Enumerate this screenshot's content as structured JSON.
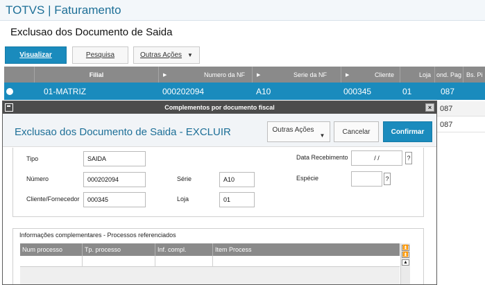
{
  "app": {
    "title": "TOTVS | Faturamento"
  },
  "page": {
    "title": "Exclusao dos Documento de Saida"
  },
  "toolbar": {
    "visualizar": "Visualizar",
    "pesquisa": "Pesquisa",
    "outras_acoes": "Outras Ações"
  },
  "grid": {
    "headers": [
      "Filial",
      "Numero da NF",
      "Serie da NF",
      "Cliente",
      "Loja",
      "ond. Pag",
      "Bs. Pi"
    ],
    "selected_row": {
      "filial": "01-MATRIZ",
      "numero": "000202094",
      "serie": "A10",
      "cliente": "000345",
      "loja": "01",
      "cond_pag": "087"
    },
    "bg_rows": [
      "087",
      "087"
    ]
  },
  "modal": {
    "header": "Complementos por documento fiscal",
    "close": "×",
    "title": "Exclusao dos Documento de Saida - EXCLUIR",
    "buttons": {
      "outras_acoes": "Outras Ações",
      "cancelar": "Cancelar",
      "confirmar": "Confirmar"
    },
    "form": {
      "tipo_label": "Tipo",
      "tipo_value": "SAIDA",
      "numero_label": "Número",
      "numero_value": "000202094",
      "cliente_label": "Cliente/Fornecedor",
      "cliente_value": "000345",
      "serie_label": "Série",
      "serie_value": "A10",
      "loja_label": "Loja",
      "loja_value": "01",
      "data_label": "Data Recebimento",
      "data_value": "/ /",
      "especie_label": "Espécie",
      "especie_value": "",
      "help": "?"
    },
    "info": {
      "legend": "Informações complementares - Processos referenciados",
      "columns": [
        "Num processo",
        "Tp. processo",
        "Inf. compl.",
        "Item Process"
      ]
    }
  },
  "icons": {
    "radio": "radio-selected-icon",
    "caret": "caret-down-icon",
    "window": "window-icon",
    "sort_arrow": "sort-arrow-icon"
  },
  "colors": {
    "accent": "#1a8bbd",
    "title": "#1d6f97",
    "grid_header": "#8a8a8a",
    "modal_header": "#4c4c4c"
  }
}
